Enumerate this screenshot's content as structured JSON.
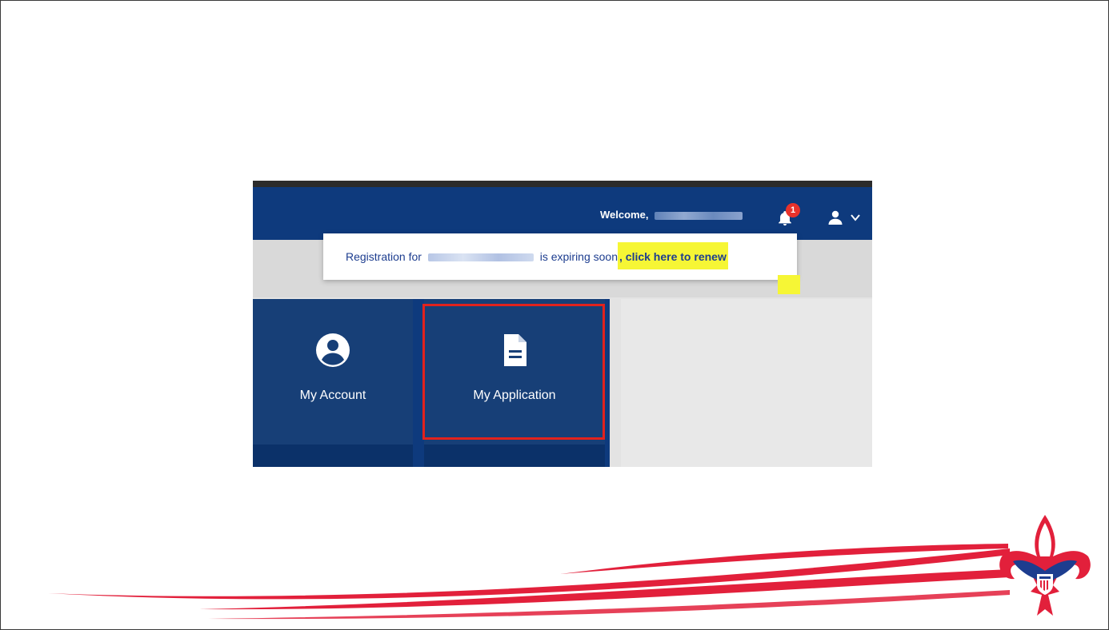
{
  "navbar": {
    "welcome_label": "Welcome,",
    "notification_count": "1"
  },
  "notice": {
    "prefix": "Registration for",
    "middle": "is expiring soon",
    "link_text": ", click here to renew"
  },
  "tiles": [
    {
      "label": "My Account",
      "icon": "account-circle-icon"
    },
    {
      "label": "My Application",
      "icon": "document-icon"
    }
  ],
  "colors": {
    "navbar": "#0e3a7d",
    "tile": "#173f77",
    "highlight": "#f6f635",
    "callout_box": "#e2221d",
    "swoosh_red": "#e2203b"
  }
}
